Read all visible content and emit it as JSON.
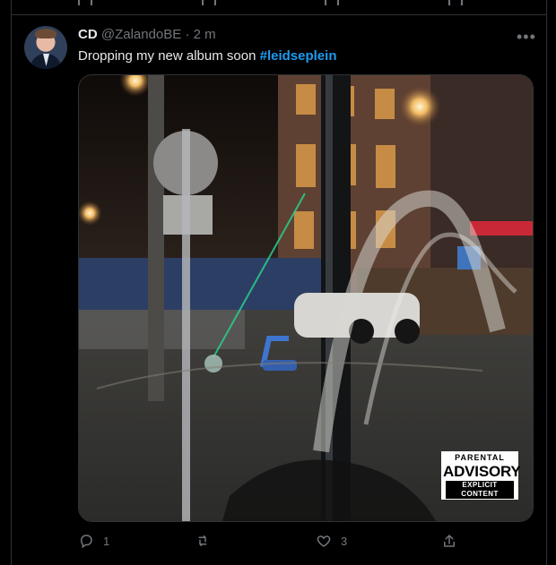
{
  "tweet": {
    "display_name": "CD",
    "handle": "@ZalandoBE",
    "separator": " · ",
    "time_ago": "2 m",
    "more_label": "•••",
    "text_before": "Dropping my new album soon ",
    "hashtag": "#leidseplein",
    "media": {
      "advisory": {
        "line1": "PARENTAL",
        "line2": "ADVISORY",
        "line3": "EXPLICIT CONTENT"
      }
    },
    "actions": {
      "reply_count": "1",
      "retweet_count": "",
      "like_count": "3"
    }
  },
  "icons": {
    "reply": "reply-icon",
    "retweet": "retweet-icon",
    "like": "heart-icon",
    "share": "share-icon",
    "more": "more-icon"
  }
}
